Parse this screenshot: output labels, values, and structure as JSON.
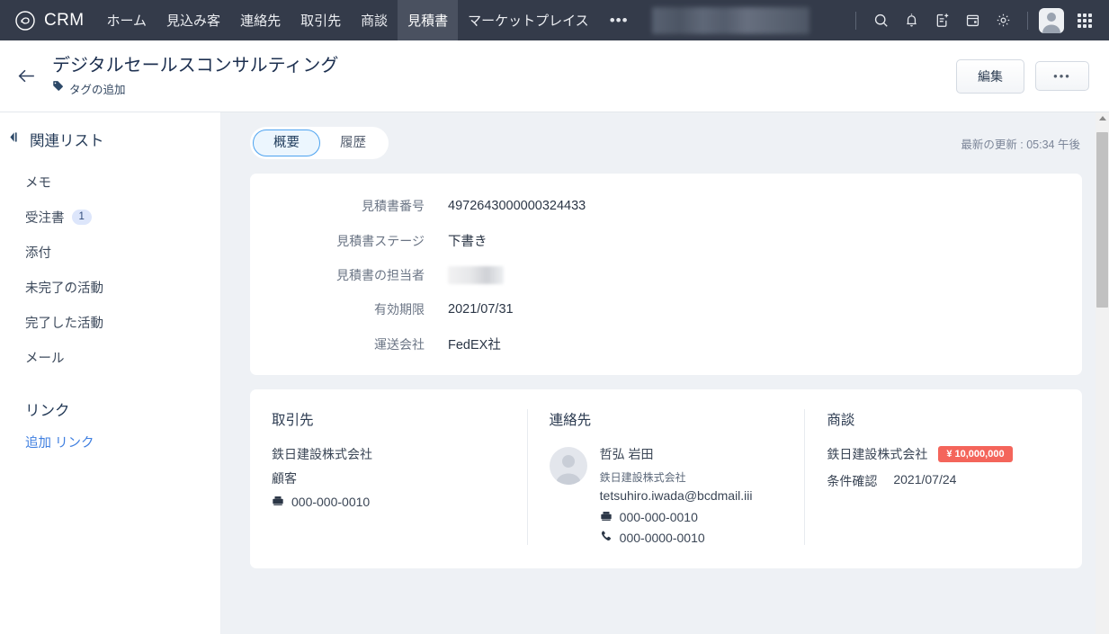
{
  "topnav": {
    "brand": "CRM",
    "brand_logo_icon": "crm-logo-icon",
    "items": [
      {
        "label": "ホーム",
        "active": false
      },
      {
        "label": "見込み客",
        "active": false
      },
      {
        "label": "連絡先",
        "active": false
      },
      {
        "label": "取引先",
        "active": false
      },
      {
        "label": "商談",
        "active": false
      },
      {
        "label": "見積書",
        "active": true
      },
      {
        "label": "マーケットプレイス",
        "active": false
      }
    ],
    "more_label": "•••",
    "redacted_search_box": "",
    "icons": [
      "search-icon",
      "bell-icon",
      "note-add-icon",
      "calendar-icon",
      "gear-icon",
      "avatar-icon",
      "apps-grid-icon"
    ],
    "nav_bg": "#343b4a",
    "active_bg": "#4a5160"
  },
  "header": {
    "back_icon": "back-arrow-icon",
    "title": "デジタルセールスコンサルティング",
    "tag_icon": "tag-icon",
    "tag_label": "タグの追加",
    "edit_label": "編集",
    "more_label": "•••"
  },
  "sidebar": {
    "collapse_icon": "collapse-panel-icon",
    "section_title": "関連リスト",
    "items": [
      {
        "label": "メモ",
        "badge": null
      },
      {
        "label": "受注書",
        "badge": "1"
      },
      {
        "label": "添付",
        "badge": null
      },
      {
        "label": "未完了の活動",
        "badge": null
      },
      {
        "label": "完了した活動",
        "badge": null
      },
      {
        "label": "メール",
        "badge": null
      }
    ],
    "links_title": "リンク",
    "add_link_label": "追加 リンク"
  },
  "content": {
    "tabs": [
      {
        "label": "概要",
        "active": true
      },
      {
        "label": "履歴",
        "active": false
      }
    ],
    "updated_text": "最新の更新 : 05:34 午後",
    "fields": [
      {
        "label": "見積書番号",
        "value": "4972643000000324433",
        "redacted": false
      },
      {
        "label": "見積書ステージ",
        "value": "下書き",
        "redacted": false
      },
      {
        "label": "見積書の担当者",
        "value": "",
        "redacted": true
      },
      {
        "label": "有効期限",
        "value": "2021/07/31",
        "redacted": false
      },
      {
        "label": "運送会社",
        "value": "FedEX社",
        "redacted": false
      }
    ],
    "related": {
      "account": {
        "title": "取引先",
        "name": "鉄日建設株式会社",
        "type": "顧客",
        "phone_icon": "telephone-icon",
        "phone": "000-000-0010"
      },
      "contact": {
        "title": "連絡先",
        "avatar_icon": "contact-avatar-icon",
        "name": "哲弘 岩田",
        "company": "鉄日建設株式会社",
        "email": "tetsuhiro.iwada@bcdmail.iii",
        "phone_icon": "telephone-icon",
        "phone": "000-000-0010",
        "mobile_icon": "mobile-phone-icon",
        "mobile": "000-0000-0010"
      },
      "deal": {
        "title": "商談",
        "name": "鉄日建設株式会社",
        "amount": "¥ 10,000,000",
        "amount_color": "#f4655b",
        "stage": "条件確認",
        "date": "2021/07/24"
      }
    }
  }
}
